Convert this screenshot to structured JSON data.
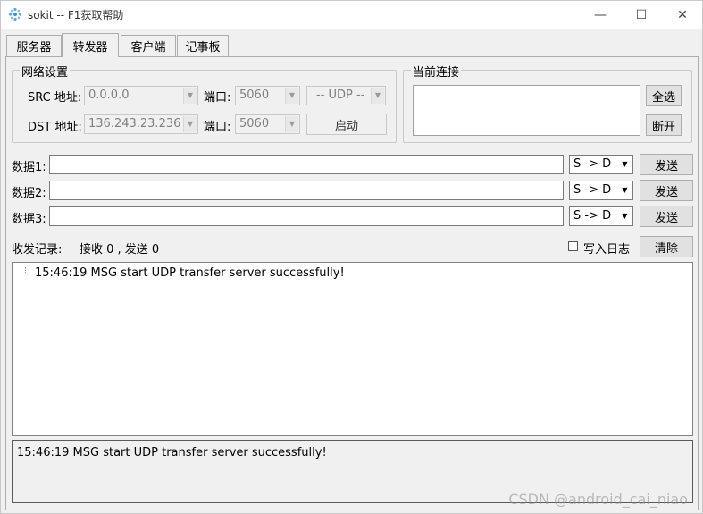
{
  "window": {
    "title": "sokit -- F1获取帮助",
    "minimize": "—",
    "maximize": "☐",
    "close": "✕"
  },
  "tabs": [
    {
      "label": "服务器"
    },
    {
      "label": "转发器"
    },
    {
      "label": "客户端"
    },
    {
      "label": "记事板"
    }
  ],
  "network": {
    "title": "网络设置",
    "src_label": "SRC 地址:",
    "src_addr": "0.0.0.0",
    "src_port_label": "端口:",
    "src_port": "5060",
    "protocol": "-- UDP --",
    "dst_label": "DST 地址:",
    "dst_addr": "136.243.23.236",
    "dst_port_label": "端口:",
    "dst_port": "5060",
    "start_button": "启动"
  },
  "connections": {
    "title": "当前连接",
    "select_all": "全选",
    "disconnect": "断开"
  },
  "data_rows": [
    {
      "label": "数据1:",
      "value": "",
      "direction": "S -> D",
      "send": "发送"
    },
    {
      "label": "数据2:",
      "value": "",
      "direction": "S -> D",
      "send": "发送"
    },
    {
      "label": "数据3:",
      "value": "",
      "direction": "S -> D",
      "send": "发送"
    }
  ],
  "records": {
    "label": "收发记录:",
    "counts": "接收 0 , 发送 0",
    "write_log": "写入日志",
    "write_log_checked": false,
    "clear": "清除"
  },
  "log": {
    "entries": [
      "15:46:19 MSG start UDP transfer server successfully!"
    ]
  },
  "status": {
    "text": "15:46:19 MSG start UDP transfer server successfully!"
  },
  "watermark": "CSDN @android_cai_niao"
}
